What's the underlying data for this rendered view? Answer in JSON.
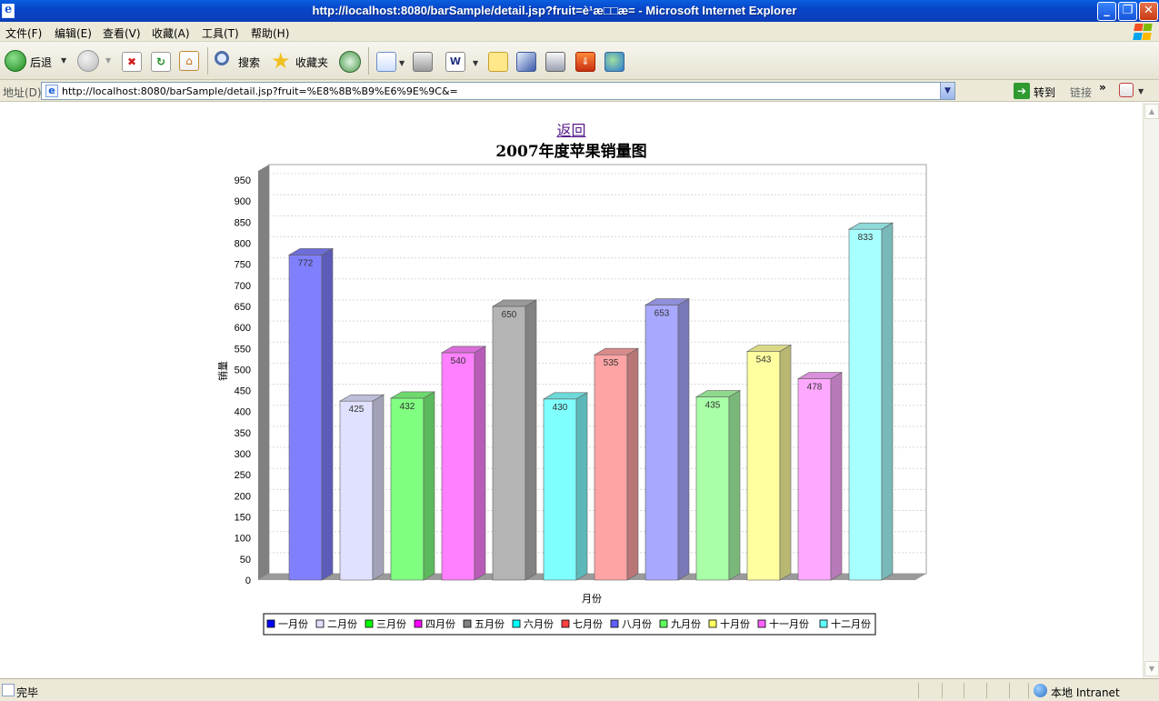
{
  "window": {
    "title": "http://localhost:8080/barSample/detail.jsp?fruit=è¹æ□□æ= - Microsoft Internet Explorer"
  },
  "menu": [
    "文件(F)",
    "编辑(E)",
    "查看(V)",
    "收藏(A)",
    "工具(T)",
    "帮助(H)"
  ],
  "toolbar": {
    "back": "后退",
    "search": "搜索",
    "favorites": "收藏夹"
  },
  "address": {
    "label": "地址(D)",
    "url": "http://localhost:8080/barSample/detail.jsp?fruit=%E8%8B%B9%E6%9E%9C&=",
    "go": "转到",
    "links": "链接"
  },
  "page": {
    "back_link": "返回",
    "chart_title": "2007年度苹果销量图"
  },
  "chart_data": {
    "type": "bar",
    "title": "2007年度苹果销量图",
    "xlabel": "月份",
    "ylabel": "销量",
    "ylim": [
      0,
      950
    ],
    "yticks": [
      0,
      50,
      100,
      150,
      200,
      250,
      300,
      350,
      400,
      450,
      500,
      550,
      600,
      650,
      700,
      750,
      800,
      850,
      900,
      950
    ],
    "grid": true,
    "legend_position": "bottom",
    "categories": [
      "一月份",
      "二月份",
      "三月份",
      "四月份",
      "五月份",
      "六月份",
      "七月份",
      "八月份",
      "九月份",
      "十月份",
      "十一月份",
      "十二月份"
    ],
    "values": [
      772,
      425,
      432,
      540,
      650,
      430,
      535,
      653,
      435,
      543,
      478,
      833
    ],
    "colors": [
      "#8080ff",
      "#e0e0ff",
      "#80ff80",
      "#ff80ff",
      "#b4b4b4",
      "#80ffff",
      "#ffa4a4",
      "#a8a8ff",
      "#a8ffa8",
      "#ffffa0",
      "#ffa8ff",
      "#a8ffff"
    ],
    "legend_colors": [
      "#0000ff",
      "#e0e0ff",
      "#00ff00",
      "#ff00ff",
      "#808080",
      "#00ffff",
      "#ff4040",
      "#6060ff",
      "#60ff60",
      "#ffff60",
      "#ff60ff",
      "#60ffff"
    ]
  },
  "status": {
    "text": "完毕",
    "zone": "本地 Intranet"
  }
}
